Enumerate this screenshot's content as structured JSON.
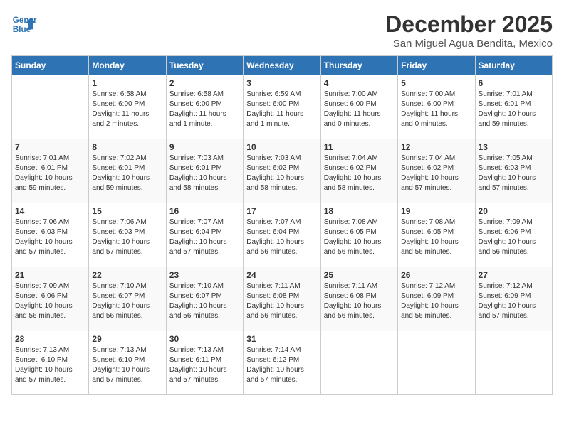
{
  "header": {
    "logo_line1": "General",
    "logo_line2": "Blue",
    "month": "December 2025",
    "location": "San Miguel Agua Bendita, Mexico"
  },
  "weekdays": [
    "Sunday",
    "Monday",
    "Tuesday",
    "Wednesday",
    "Thursday",
    "Friday",
    "Saturday"
  ],
  "weeks": [
    [
      {
        "day": "",
        "info": ""
      },
      {
        "day": "1",
        "info": "Sunrise: 6:58 AM\nSunset: 6:00 PM\nDaylight: 11 hours\nand 2 minutes."
      },
      {
        "day": "2",
        "info": "Sunrise: 6:58 AM\nSunset: 6:00 PM\nDaylight: 11 hours\nand 1 minute."
      },
      {
        "day": "3",
        "info": "Sunrise: 6:59 AM\nSunset: 6:00 PM\nDaylight: 11 hours\nand 1 minute."
      },
      {
        "day": "4",
        "info": "Sunrise: 7:00 AM\nSunset: 6:00 PM\nDaylight: 11 hours\nand 0 minutes."
      },
      {
        "day": "5",
        "info": "Sunrise: 7:00 AM\nSunset: 6:00 PM\nDaylight: 11 hours\nand 0 minutes."
      },
      {
        "day": "6",
        "info": "Sunrise: 7:01 AM\nSunset: 6:01 PM\nDaylight: 10 hours\nand 59 minutes."
      }
    ],
    [
      {
        "day": "7",
        "info": "Sunrise: 7:01 AM\nSunset: 6:01 PM\nDaylight: 10 hours\nand 59 minutes."
      },
      {
        "day": "8",
        "info": "Sunrise: 7:02 AM\nSunset: 6:01 PM\nDaylight: 10 hours\nand 59 minutes."
      },
      {
        "day": "9",
        "info": "Sunrise: 7:03 AM\nSunset: 6:01 PM\nDaylight: 10 hours\nand 58 minutes."
      },
      {
        "day": "10",
        "info": "Sunrise: 7:03 AM\nSunset: 6:02 PM\nDaylight: 10 hours\nand 58 minutes."
      },
      {
        "day": "11",
        "info": "Sunrise: 7:04 AM\nSunset: 6:02 PM\nDaylight: 10 hours\nand 58 minutes."
      },
      {
        "day": "12",
        "info": "Sunrise: 7:04 AM\nSunset: 6:02 PM\nDaylight: 10 hours\nand 57 minutes."
      },
      {
        "day": "13",
        "info": "Sunrise: 7:05 AM\nSunset: 6:03 PM\nDaylight: 10 hours\nand 57 minutes."
      }
    ],
    [
      {
        "day": "14",
        "info": "Sunrise: 7:06 AM\nSunset: 6:03 PM\nDaylight: 10 hours\nand 57 minutes."
      },
      {
        "day": "15",
        "info": "Sunrise: 7:06 AM\nSunset: 6:03 PM\nDaylight: 10 hours\nand 57 minutes."
      },
      {
        "day": "16",
        "info": "Sunrise: 7:07 AM\nSunset: 6:04 PM\nDaylight: 10 hours\nand 57 minutes."
      },
      {
        "day": "17",
        "info": "Sunrise: 7:07 AM\nSunset: 6:04 PM\nDaylight: 10 hours\nand 56 minutes."
      },
      {
        "day": "18",
        "info": "Sunrise: 7:08 AM\nSunset: 6:05 PM\nDaylight: 10 hours\nand 56 minutes."
      },
      {
        "day": "19",
        "info": "Sunrise: 7:08 AM\nSunset: 6:05 PM\nDaylight: 10 hours\nand 56 minutes."
      },
      {
        "day": "20",
        "info": "Sunrise: 7:09 AM\nSunset: 6:06 PM\nDaylight: 10 hours\nand 56 minutes."
      }
    ],
    [
      {
        "day": "21",
        "info": "Sunrise: 7:09 AM\nSunset: 6:06 PM\nDaylight: 10 hours\nand 56 minutes."
      },
      {
        "day": "22",
        "info": "Sunrise: 7:10 AM\nSunset: 6:07 PM\nDaylight: 10 hours\nand 56 minutes."
      },
      {
        "day": "23",
        "info": "Sunrise: 7:10 AM\nSunset: 6:07 PM\nDaylight: 10 hours\nand 56 minutes."
      },
      {
        "day": "24",
        "info": "Sunrise: 7:11 AM\nSunset: 6:08 PM\nDaylight: 10 hours\nand 56 minutes."
      },
      {
        "day": "25",
        "info": "Sunrise: 7:11 AM\nSunset: 6:08 PM\nDaylight: 10 hours\nand 56 minutes."
      },
      {
        "day": "26",
        "info": "Sunrise: 7:12 AM\nSunset: 6:09 PM\nDaylight: 10 hours\nand 56 minutes."
      },
      {
        "day": "27",
        "info": "Sunrise: 7:12 AM\nSunset: 6:09 PM\nDaylight: 10 hours\nand 57 minutes."
      }
    ],
    [
      {
        "day": "28",
        "info": "Sunrise: 7:13 AM\nSunset: 6:10 PM\nDaylight: 10 hours\nand 57 minutes."
      },
      {
        "day": "29",
        "info": "Sunrise: 7:13 AM\nSunset: 6:10 PM\nDaylight: 10 hours\nand 57 minutes."
      },
      {
        "day": "30",
        "info": "Sunrise: 7:13 AM\nSunset: 6:11 PM\nDaylight: 10 hours\nand 57 minutes."
      },
      {
        "day": "31",
        "info": "Sunrise: 7:14 AM\nSunset: 6:12 PM\nDaylight: 10 hours\nand 57 minutes."
      },
      {
        "day": "",
        "info": ""
      },
      {
        "day": "",
        "info": ""
      },
      {
        "day": "",
        "info": ""
      }
    ]
  ]
}
